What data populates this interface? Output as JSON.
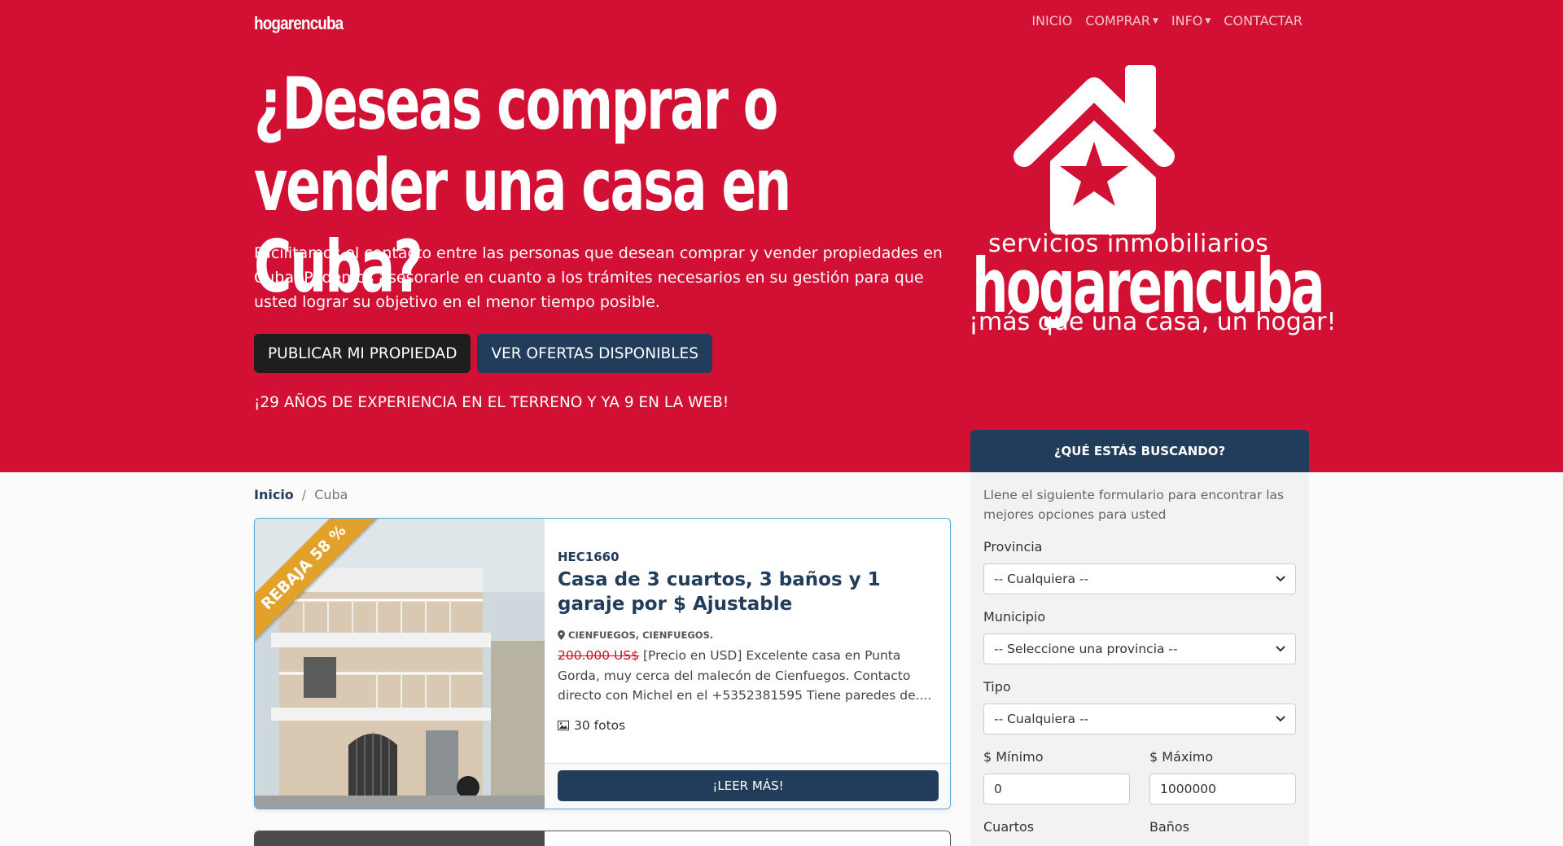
{
  "header": {
    "brand": "hogarencuba",
    "nav": [
      {
        "label": "INICIO",
        "dropdown": false
      },
      {
        "label": "COMPRAR",
        "dropdown": true
      },
      {
        "label": "INFO",
        "dropdown": true
      },
      {
        "label": "CONTACTAR",
        "dropdown": false
      }
    ]
  },
  "hero": {
    "title_line1": "¿Deseas comprar o",
    "title_line2": "vender una casa en Cuba?",
    "description": "Facilitamos el contacto entre las personas que desean comprar y vender propiedades en Cuba. Podemos asesorarle en cuanto a los trámites necesarios en su gestión para que usted lograr su objetivo en el menor tiempo posible.",
    "btn_publish": "PUBLICAR MI PROPIEDAD",
    "btn_offers": "VER OFERTAS DISPONIBLES",
    "experience": "¡29 AÑOS DE EXPERIENCIA EN EL TERRENO Y YA 9 EN LA WEB!",
    "logo": {
      "tagline_top": "servicios inmobiliarios",
      "name": "hogarencuba",
      "tagline_bottom": "¡más que una casa, un hogar!"
    }
  },
  "breadcrumb": {
    "home": "Inicio",
    "separator": "/",
    "current": "Cuba"
  },
  "listings": [
    {
      "ribbon": "REBAJA 58 %",
      "code": "HEC1660",
      "title": "Casa de 3 cuartos, 3 baños y 1 garaje por $ Ajustable",
      "location": "CIENFUEGOS, CIENFUEGOS.",
      "old_price": "200.000 US$",
      "description": " [Precio en USD] Excelente casa en Punta Gorda, muy cerca del malecón de Cienfuegos. Contacto directo con Michel en el +5352381595 Tiene paredes de....",
      "photos": "30 fotos",
      "read_more": "¡LEER MÁS!"
    }
  ],
  "search": {
    "heading": "¿QUÉ ESTÁS BUSCANDO?",
    "intro": "Llene el siguiente formulario para encontrar las mejores opciones para usted",
    "provincia_label": "Provincia",
    "provincia_value": "-- Cualquiera --",
    "municipio_label": "Municipio",
    "municipio_value": "-- Seleccione una provincia --",
    "tipo_label": "Tipo",
    "tipo_value": "-- Cualquiera --",
    "min_label": "$ Mínimo",
    "min_value": "0",
    "max_label": "$ Máximo",
    "max_value": "1000000",
    "cuartos_label": "Cuartos",
    "banos_label": "Baños"
  },
  "colors": {
    "brand_red": "#d21033",
    "navy": "#223d5c",
    "ribbon": "#e1a12b",
    "strike": "#c91030"
  }
}
